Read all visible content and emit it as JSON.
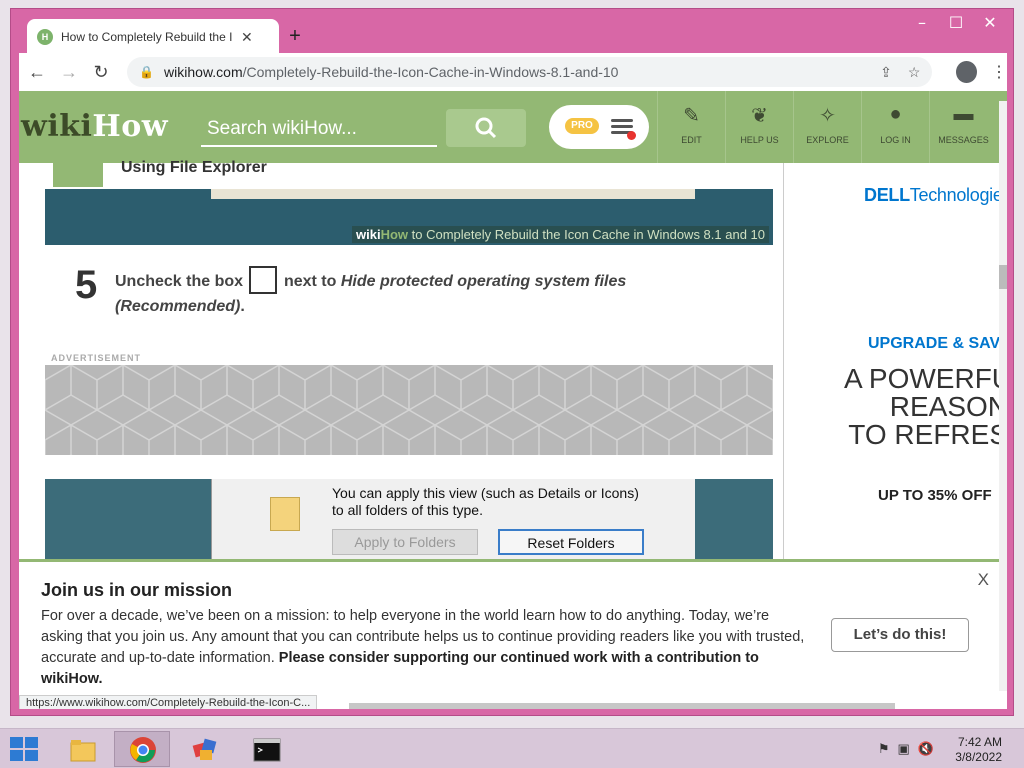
{
  "window": {
    "controls": [
      "–",
      "☐",
      "✕"
    ]
  },
  "tab": {
    "favicon_text": "H",
    "title": "How to Completely Rebuild the I",
    "close": "✕",
    "new_tab": "+"
  },
  "toolbar": {
    "back": "←",
    "forward": "→",
    "reload": "↻",
    "lock": "🔒",
    "url_host": "wikihow.com",
    "url_path": "/Completely-Rebuild-the-Icon-Cache-in-Windows-8.1-and-10",
    "share": "⇪",
    "star": "☆",
    "menu": "⋮"
  },
  "wikihow": {
    "logo_wiki": "wiki",
    "logo_how": "How",
    "search_placeholder": "Search wikiHow...",
    "pro_badge": "PRO",
    "nav": [
      {
        "icon": "✎",
        "label": "EDIT",
        "icon_name": "pencil-icon"
      },
      {
        "icon": "❦",
        "label": "HELP US",
        "icon_name": "sprout-icon"
      },
      {
        "icon": "✧",
        "label": "EXPLORE",
        "icon_name": "compass-icon"
      },
      {
        "icon": "●",
        "label": "LOG IN",
        "icon_name": "user-icon"
      },
      {
        "icon": "▬",
        "label": "MESSAGES",
        "icon_name": "chat-icon"
      }
    ],
    "brand_color": "#93b874"
  },
  "article": {
    "section_heading": "Using File Explorer",
    "image1_caption_wiki": "wiki",
    "image1_caption_how": "How",
    "image1_caption": " to Completely Rebuild the Icon Cache in Windows 8.1 and 10",
    "step_number": "5",
    "step_text_1": "Uncheck the box",
    "step_text_2": "next to",
    "step_text_em": "Hide protected operating system files (Recommended)",
    "step_text_end": ".",
    "advertisement_label": "ADVERTISEMENT",
    "dialog_message": "You can apply this view (such as Details or Icons) to all folders of this type.",
    "dialog_btn_apply": "Apply to Folders",
    "dialog_btn_reset": "Reset Folders"
  },
  "sidebar_ad": {
    "dell_bold": "DELL",
    "dell_rest": "Technologies",
    "upgrade": "UPGRADE & SAVE",
    "powerful_1": "A POWERFU",
    "powerful_2": "REASON",
    "powerful_3": "TO REFRES",
    "discount": "UP TO 35% OFF"
  },
  "banner": {
    "close": "X",
    "title": "Join us in our mission",
    "body": "For over a decade, we’ve been on a mission: to help everyone in the world learn how to do anything. Today, we’re asking that you join us. Any amount that you can contribute helps us to continue providing readers like you with trusted, accurate and up-to-date information. ",
    "body_bold": "Please consider supporting our continued work with a contribution to wikiHow.",
    "cta": "Let’s do this!"
  },
  "status_url": "https://www.wikihow.com/Completely-Rebuild-the-Icon-C...",
  "taskbar": {
    "time": "7:42 AM",
    "date": "3/8/2022"
  }
}
